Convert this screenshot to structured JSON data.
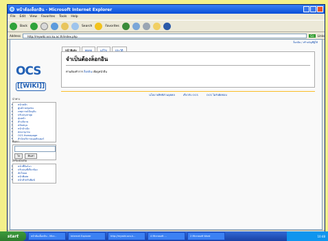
{
  "window": {
    "title": "หน้าต้องล็อกอิน - Microsoft Internet Explorer"
  },
  "menubar": [
    "File",
    "Edit",
    "View",
    "Favorites",
    "Tools",
    "Help"
  ],
  "toolbar": {
    "back": "Back",
    "search": "Search",
    "favorites": "Favorites"
  },
  "addressbar": {
    "label": "Address",
    "url": "http://mywiki.ocs.ku.ac.th/index.php",
    "go": "Go",
    "links": "Links"
  },
  "page": {
    "toplinks": "ล็อกอิน / สร้างบัญชีผู้ใช้",
    "tabs": [
      "หน้าพิเศษ",
      "พูดคุย",
      "แก้ไข",
      "ประวัติ"
    ],
    "logo": {
      "name": "OCS",
      "sub": "[[WIKI]]"
    },
    "heading": "จำเป็นต้องล็อกอิน",
    "message": "ท่านต้องทำการ",
    "message_link": "ล็อกอิน",
    "message_tail": "เพื่อดูหน้าอื่น",
    "footer": [
      "นโยบายสิทธิส่วนบุคคล",
      "เกี่ยวกับ OCS",
      "OCS ไม่รับผิดชอบ"
    ]
  },
  "sidebar": {
    "nav_title": "นำทาง",
    "nav_items": [
      "หน้าหลัก",
      "ศูนย์รวมชุมชน",
      "เหตุการณ์ปัจจุบัน",
      "ปรับปรุงล่าสุด",
      "สุ่มหน้า",
      "คำอธิบาย",
      "สนับสนุน",
      "หน้าอ้างอิง",
      "พจนานุกรม",
      "OCS Homepage",
      "สำนักบริการคอมพิวเตอร์"
    ],
    "search_title": "ค้นหา",
    "search_go": "ไป",
    "search_btn": "ค้นหา",
    "tools_title": "เครื่องมือเพิ่ม",
    "tools_items": [
      "หน้าที่ลิงก์มา",
      "ปรับปรุงที่เกี่ยวข้อง",
      "อัปโหลด",
      "หน้าพิเศษ",
      "หน้าสำหรับพิมพ์"
    ]
  },
  "status": {
    "text": "Done",
    "zone": "Internet"
  },
  "taskbar": {
    "start": "start",
    "tasks": [
      "หน้าต้องล็อกอิน - Micr...",
      "Internet Explorer",
      "http://mywiki.ocs.k...",
      "4 Microsoft ...",
      "2 Microsoft Word"
    ],
    "clock": "10:48"
  },
  "colors": {
    "accent": "#2361b5",
    "link": "#0645ad",
    "taskbar": "#245edb",
    "background": "#f3f08a"
  }
}
